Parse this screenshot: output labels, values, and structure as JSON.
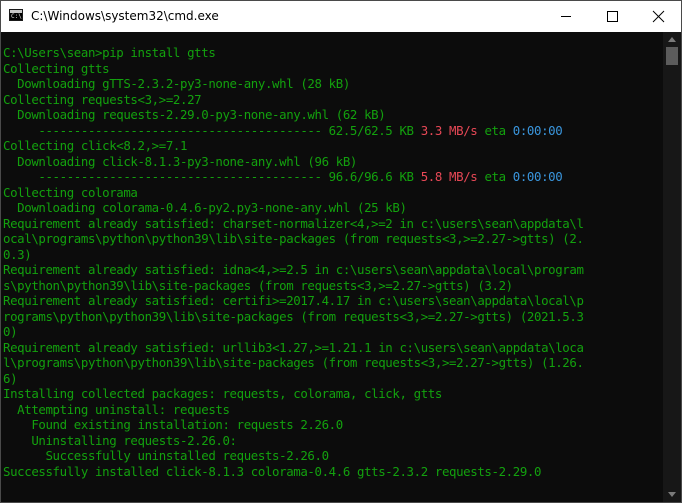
{
  "window": {
    "title": "C:\\Windows\\system32\\cmd.exe",
    "icon_prompt": "C:\\",
    "controls": {
      "minimize_icon": "minimize-icon",
      "maximize_icon": "maximize-icon",
      "close_icon": "close-icon"
    }
  },
  "colors": {
    "background": "#0c0c0c",
    "text_green": "#13a10e",
    "text_red": "#e74856",
    "text_cyan": "#3a96dd"
  },
  "console": {
    "lines": [
      [
        {
          "t": "C:\\Users\\sean>pip install gtts"
        }
      ],
      [
        {
          "t": "Collecting gtts"
        }
      ],
      [
        {
          "t": "  Downloading gTTS-2.3.2-py3-none-any.whl (28 kB)"
        }
      ],
      [
        {
          "t": "Collecting requests<3,>=2.27"
        }
      ],
      [
        {
          "t": "  Downloading requests-2.29.0-py3-none-any.whl (62 kB)"
        }
      ],
      [
        {
          "t": "     ---------------------------------------- 62.5/62.5 KB "
        },
        {
          "t": "3.3 MB/s",
          "c": "red"
        },
        {
          "t": " eta "
        },
        {
          "t": "0:00:00",
          "c": "cyan"
        }
      ],
      [
        {
          "t": "Collecting click<8.2,>=7.1"
        }
      ],
      [
        {
          "t": "  Downloading click-8.1.3-py3-none-any.whl (96 kB)"
        }
      ],
      [
        {
          "t": "     ---------------------------------------- 96.6/96.6 KB "
        },
        {
          "t": "5.8 MB/s",
          "c": "red"
        },
        {
          "t": " eta "
        },
        {
          "t": "0:00:00",
          "c": "cyan"
        }
      ],
      [
        {
          "t": "Collecting colorama"
        }
      ],
      [
        {
          "t": "  Downloading colorama-0.4.6-py2.py3-none-any.whl (25 kB)"
        }
      ],
      [
        {
          "t": "Requirement already satisfied: charset-normalizer<4,>=2 in c:\\users\\sean\\appdata\\l"
        }
      ],
      [
        {
          "t": "ocal\\programs\\python\\python39\\lib\\site-packages (from requests<3,>=2.27->gtts) (2."
        }
      ],
      [
        {
          "t": "0.3)"
        }
      ],
      [
        {
          "t": "Requirement already satisfied: idna<4,>=2.5 in c:\\users\\sean\\appdata\\local\\program"
        }
      ],
      [
        {
          "t": "s\\python\\python39\\lib\\site-packages (from requests<3,>=2.27->gtts) (3.2)"
        }
      ],
      [
        {
          "t": "Requirement already satisfied: certifi>=2017.4.17 in c:\\users\\sean\\appdata\\local\\p"
        }
      ],
      [
        {
          "t": "rograms\\python\\python39\\lib\\site-packages (from requests<3,>=2.27->gtts) (2021.5.3"
        }
      ],
      [
        {
          "t": "0)"
        }
      ],
      [
        {
          "t": "Requirement already satisfied: urllib3<1.27,>=1.21.1 in c:\\users\\sean\\appdata\\loca"
        }
      ],
      [
        {
          "t": "l\\programs\\python\\python39\\lib\\site-packages (from requests<3,>=2.27->gtts) (1.26."
        }
      ],
      [
        {
          "t": "6)"
        }
      ],
      [
        {
          "t": "Installing collected packages: requests, colorama, click, gtts"
        }
      ],
      [
        {
          "t": "  Attempting uninstall: requests"
        }
      ],
      [
        {
          "t": "    Found existing installation: requests 2.26.0"
        }
      ],
      [
        {
          "t": "    Uninstalling requests-2.26.0:"
        }
      ],
      [
        {
          "t": "      Successfully uninstalled requests-2.26.0"
        }
      ],
      [
        {
          "t": "Successfully installed click-8.1.3 colorama-0.4.6 gtts-2.3.2 requests-2.29.0"
        }
      ]
    ]
  },
  "scrollbar": {
    "up_icon": "scroll-up-arrow-icon",
    "down_icon": "scroll-down-arrow-icon"
  }
}
